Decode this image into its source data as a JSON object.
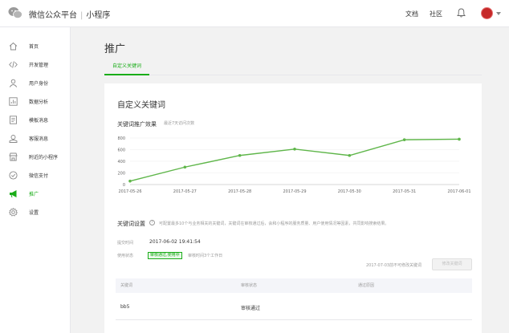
{
  "header": {
    "platform": "微信公众平台",
    "separator": "|",
    "product": "小程序",
    "links": [
      "文档",
      "社区"
    ]
  },
  "sidebar": {
    "items": [
      {
        "label": "首页",
        "icon": "home-icon"
      },
      {
        "label": "开发管理",
        "icon": "code-icon"
      },
      {
        "label": "用户身份",
        "icon": "user-icon"
      },
      {
        "label": "数据分析",
        "icon": "bar-chart-icon"
      },
      {
        "label": "模板消息",
        "icon": "document-icon"
      },
      {
        "label": "客服消息",
        "icon": "customer-service-icon"
      },
      {
        "label": "附近的小程序",
        "icon": "store-icon"
      },
      {
        "label": "微信支付",
        "icon": "payment-icon"
      },
      {
        "label": "推广",
        "icon": "megaphone-icon",
        "active": true
      },
      {
        "label": "设置",
        "icon": "gear-icon"
      }
    ]
  },
  "page": {
    "title": "推广",
    "tab": "自定义关键词"
  },
  "card": {
    "title": "自定义关键词",
    "chart_title": "关键词推广效果",
    "chart_hint": "最近7天访问次数"
  },
  "chart_data": {
    "type": "line",
    "x": [
      "2017-05-26",
      "2017-05-27",
      "2017-05-28",
      "2017-05-29",
      "2017-05-30",
      "2017-05-31",
      "2017-06-01"
    ],
    "y": [
      60,
      300,
      500,
      610,
      500,
      770,
      780
    ],
    "yticks": [
      0,
      200,
      400,
      600,
      800
    ],
    "ylim": [
      0,
      800
    ],
    "color": "#5fb64a",
    "grid": true
  },
  "keywords": {
    "title": "关键词设置",
    "description": "可配置最多10个与业务相关的关键词，关键词在审核通过后，会和小程序的服务质量、用户使用情况等因素，共同影响搜索结果。",
    "submit_time_label": "提交时间",
    "submit_time": "2017-06-02 19:41:54",
    "status_label": "使用状态",
    "status": "审核通过,使用中",
    "status_note": "审核时间3个工作日",
    "modify_note": "2017-07-03前不可修改关键词",
    "modify_button": "修改关键词",
    "columns": [
      "关键词",
      "审核状态",
      "通过原因"
    ],
    "rows": [
      {
        "keyword": "bb5",
        "status": "审核通过",
        "reason": ""
      }
    ]
  }
}
